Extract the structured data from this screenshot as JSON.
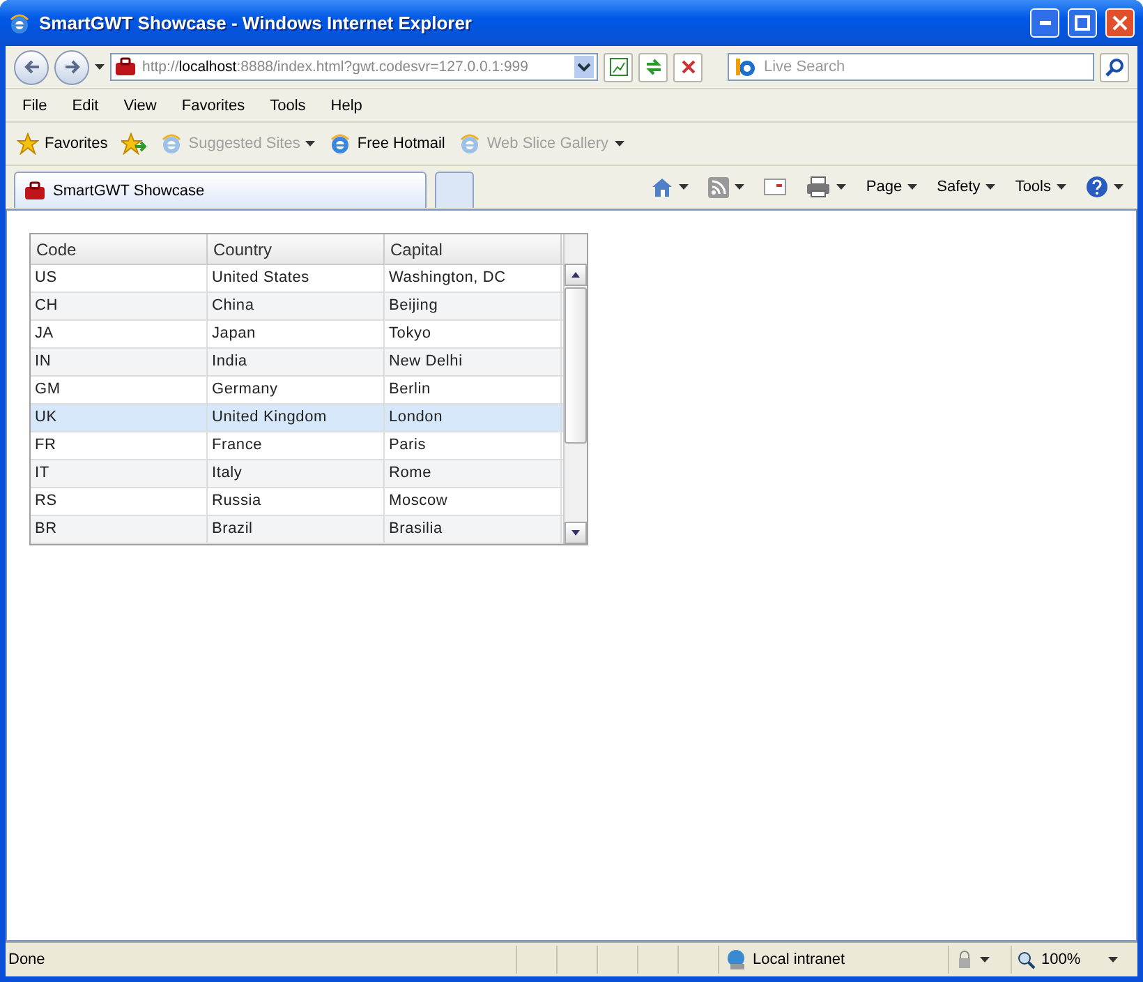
{
  "window": {
    "title": "SmartGWT Showcase - Windows Internet Explorer"
  },
  "address": {
    "scheme": "http://",
    "host": "localhost",
    "rest": ":8888/index.html?gwt.codesvr=127.0.0.1:999"
  },
  "search": {
    "placeholder": "Live Search"
  },
  "menu": [
    "File",
    "Edit",
    "View",
    "Favorites",
    "Tools",
    "Help"
  ],
  "favorites_bar": [
    {
      "kind": "star",
      "label": "Favorites",
      "dimmed": false,
      "dropdown": false
    },
    {
      "kind": "add",
      "dropdown": false
    },
    {
      "kind": "ie",
      "label": "Suggested Sites",
      "dimmed": true,
      "dropdown": true
    },
    {
      "kind": "ie",
      "label": "Free Hotmail",
      "dimmed": false,
      "dropdown": false
    },
    {
      "kind": "ie",
      "label": "Web Slice Gallery",
      "dimmed": true,
      "dropdown": true
    }
  ],
  "tabs": [
    {
      "label": "SmartGWT Showcase",
      "selected": true
    }
  ],
  "command_bar": [
    {
      "kind": "home",
      "dropdown": true
    },
    {
      "kind": "feed",
      "dropdown": true
    },
    {
      "kind": "mail",
      "dropdown": false
    },
    {
      "kind": "print",
      "dropdown": true
    },
    {
      "kind": "text",
      "label": "Page",
      "dropdown": true
    },
    {
      "kind": "text",
      "label": "Safety",
      "dropdown": true
    },
    {
      "kind": "text",
      "label": "Tools",
      "dropdown": true
    },
    {
      "kind": "help",
      "dropdown": true
    }
  ],
  "table": {
    "columns": [
      "Code",
      "Country",
      "Capital"
    ],
    "rows": [
      {
        "cells": [
          "US",
          "United States",
          "Washington, DC"
        ],
        "selected": false
      },
      {
        "cells": [
          "CH",
          "China",
          "Beijing"
        ],
        "selected": false
      },
      {
        "cells": [
          "JA",
          "Japan",
          "Tokyo"
        ],
        "selected": false
      },
      {
        "cells": [
          "IN",
          "India",
          "New Delhi"
        ],
        "selected": false
      },
      {
        "cells": [
          "GM",
          "Germany",
          "Berlin"
        ],
        "selected": false
      },
      {
        "cells": [
          "UK",
          "United Kingdom",
          "London"
        ],
        "selected": true
      },
      {
        "cells": [
          "FR",
          "France",
          "Paris"
        ],
        "selected": false
      },
      {
        "cells": [
          "IT",
          "Italy",
          "Rome"
        ],
        "selected": false
      },
      {
        "cells": [
          "RS",
          "Russia",
          "Moscow"
        ],
        "selected": false
      },
      {
        "cells": [
          "BR",
          "Brazil",
          "Brasilia"
        ],
        "selected": false
      }
    ]
  },
  "status_bar": {
    "status": "Done",
    "zone": "Local intranet",
    "zoom": "100%"
  }
}
